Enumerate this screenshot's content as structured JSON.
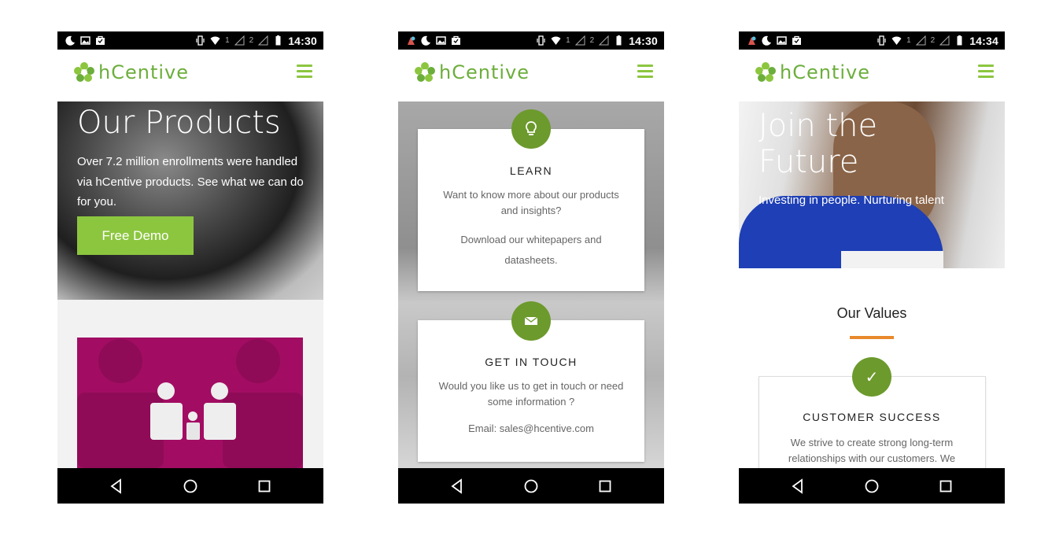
{
  "status_bar": {
    "phone1_time": "14:30",
    "phone2_time": "14:30",
    "phone3_time": "14:34",
    "sim1": "1",
    "sim2": "2"
  },
  "brand": {
    "name": "hCentive",
    "logo_color": "#6cae3b",
    "accent": "#8cc63f",
    "badge_color": "#6c9a2c",
    "rule_color": "#e8892b"
  },
  "icons": {
    "menu": "hamburger-menu-icon",
    "back": "back-triangle-icon",
    "home": "home-circle-icon",
    "recents": "recents-square-icon",
    "learn": "lightbulb-icon",
    "touch": "envelope-icon",
    "success": "checkmark-icon"
  },
  "products_page": {
    "title": "Our Products",
    "text": "Over 7.2 million enrollments were handled via hCentive products. See what we can do for you.",
    "demo_button": "Free Demo"
  },
  "contact_page": {
    "learn": {
      "title": "LEARN",
      "text1": "Want to know more about our products and insights?",
      "text2": "Download our whitepapers and datasheets."
    },
    "touch": {
      "title": "GET IN TOUCH",
      "text1": "Would you like us to get in touch or need some information ?",
      "text2": "Email: sales@hcentive.com"
    }
  },
  "careers_page": {
    "title": "Join the Future",
    "subtitle": "Investing in people. Nurturing talent",
    "values_title": "Our Values",
    "value_card": {
      "title": "CUSTOMER SUCCESS",
      "text": "We strive to create strong long-term relationships with our customers. We"
    }
  }
}
